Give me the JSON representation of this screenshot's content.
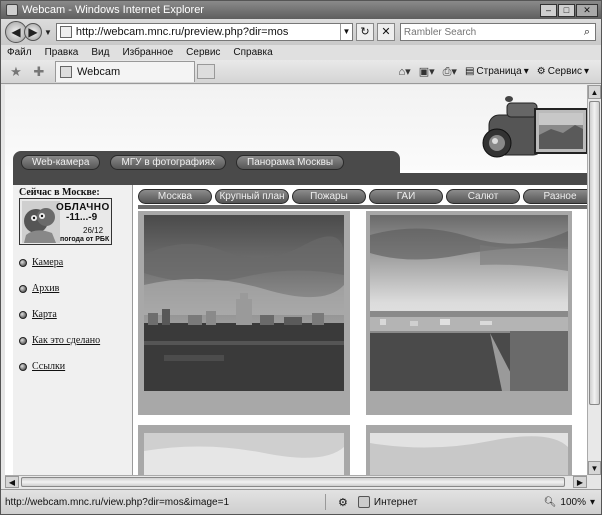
{
  "window": {
    "title": "Webcam - Windows Internet Explorer",
    "minimize_glyph": "–",
    "maximize_glyph": "□",
    "close_glyph": "✕"
  },
  "address_bar": {
    "url": "http://webcam.mnc.ru/preview.php?dir=mos"
  },
  "search": {
    "placeholder": "Rambler Search"
  },
  "menu": {
    "items": [
      "Файл",
      "Правка",
      "Вид",
      "Избранное",
      "Сервис",
      "Справка"
    ]
  },
  "tab": {
    "title": "Webcam"
  },
  "commands": {
    "page": "Страница",
    "tools": "Сервис"
  },
  "site": {
    "top_nav": [
      "Web-камера",
      "МГУ в фотографиях",
      "Панорама Москвы"
    ],
    "sub_nav": [
      "Москва",
      "Крупный план",
      "Пожары",
      "ГАИ",
      "Салют",
      "Разное"
    ],
    "weather": {
      "title": "Сейчас в Москве:",
      "condition": "ОБЛАЧНО",
      "temperature": "-11...-9",
      "date": "26/12",
      "source": "погода от РБК"
    },
    "sidebar_links": [
      "Камера",
      "Архив",
      "Карта",
      "Как это сделано",
      "Ссылки"
    ]
  },
  "status_bar": {
    "url": "http://webcam.mnc.ru/view.php?dir=mos&image=1",
    "zone": "Интернет",
    "zoom": "100%"
  }
}
